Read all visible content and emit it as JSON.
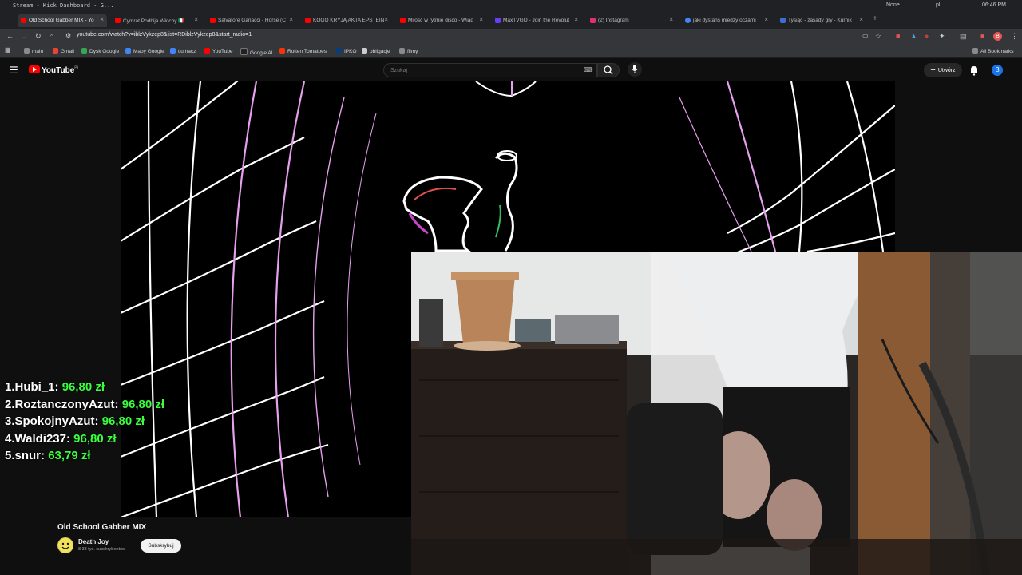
{
  "os_bar": {
    "title": "Stream - Kick Dashboard - G...",
    "profile": "None",
    "language": "pl",
    "clock": "06:46 PM"
  },
  "tabs": [
    {
      "label": "Old School Gabber MIX - Yo",
      "active": true,
      "color": "#ff0000"
    },
    {
      "label": "Cymrat Podbija Włochy 🇮🇹",
      "active": false,
      "color": "#ff0000"
    },
    {
      "label": "Salvatore Ganacci - Horse (C",
      "active": false,
      "color": "#ff0000"
    },
    {
      "label": "KOGO KRYJĄ AKTA EPSTEIN",
      "active": false,
      "color": "#ff0000"
    },
    {
      "label": "Miłość w rytmie disco - Wiad",
      "active": false,
      "color": "#ff0000"
    },
    {
      "label": "MaxTVGO - Join the Revolut",
      "active": false,
      "color": "#6a3df5"
    },
    {
      "label": "(2) Instagram",
      "active": false,
      "color": "#e1306c"
    },
    {
      "label": "jaki dystans miedzy oczami",
      "active": false,
      "color": "#4285f4"
    },
    {
      "label": "Tysiąc - zasady gry - Kurnik",
      "active": false,
      "color": "#3b6fd6"
    }
  ],
  "address": {
    "url": "youtube.com/watch?v=iblzVykzep8&list=RDiblzVykzep8&start_radio=1"
  },
  "bookmarks": [
    {
      "label": "main",
      "color": "#8a8a8a"
    },
    {
      "label": "Gmail",
      "color": "#ea4335"
    },
    {
      "label": "Dysk Google",
      "color": "#34a853"
    },
    {
      "label": "Mapy Google",
      "color": "#4285f4"
    },
    {
      "label": "tłumacz",
      "color": "#4285f4"
    },
    {
      "label": "YouTube",
      "color": "#ff0000"
    },
    {
      "label": "Google AI",
      "color": "#222222"
    },
    {
      "label": "Rotten Tomatoes",
      "color": "#fa320a"
    },
    {
      "label": "IPKO",
      "color": "#0a3d7a"
    },
    {
      "label": "obligacje",
      "color": "#cccccc"
    },
    {
      "label": "filmy",
      "color": "#8a8a8a"
    }
  ],
  "all_bookmarks": "All Bookmarks",
  "youtube": {
    "logo_text": "YouTube",
    "logo_region": "PL",
    "search_placeholder": "Szukaj",
    "create_label": "Utwórz",
    "avatar_letter": "B"
  },
  "leaderboard": [
    {
      "rank": "1.",
      "name": "Hubi_1:",
      "amount": "96,80 zł"
    },
    {
      "rank": "2.",
      "name": "RoztanczonyAzut:",
      "amount": "96,80 zł"
    },
    {
      "rank": "3.",
      "name": "SpokojnyAzut:",
      "amount": "96,80 zł"
    },
    {
      "rank": "4.",
      "name": "Waldi237:",
      "amount": "96,80 zł"
    },
    {
      "rank": "5.",
      "name": "snur:",
      "amount": "63,79 zł"
    }
  ],
  "video_info": {
    "title": "Old School Gabber MIX",
    "channel": "Death Joy",
    "subscribers": "8,33 tys. subskrybentów",
    "subscribe_label": "Subskrybuj"
  },
  "colors": {
    "accent_green": "#39ff3d",
    "youtube_red": "#ff0000",
    "grid_white": "#ffffff",
    "grid_pink": "#e7a0ee"
  }
}
